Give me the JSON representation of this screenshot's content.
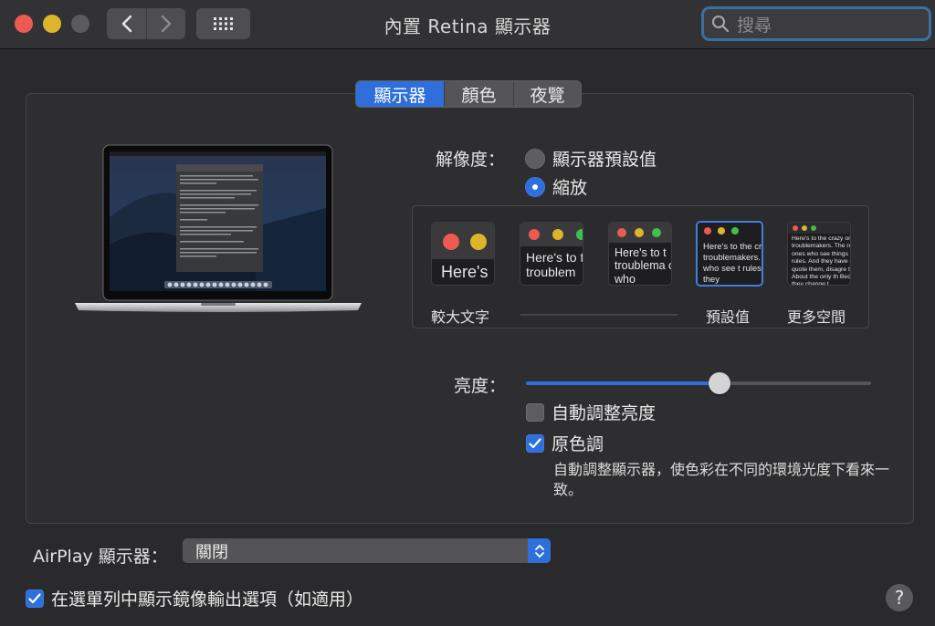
{
  "window": {
    "title": "內置 Retina 顯示器",
    "search_placeholder": "搜尋"
  },
  "tabs": [
    {
      "label": "顯示器",
      "active": true
    },
    {
      "label": "顏色",
      "active": false
    },
    {
      "label": "夜覽",
      "active": false
    }
  ],
  "resolution": {
    "label": "解像度：",
    "options": [
      {
        "label": "顯示器預設值",
        "selected": false
      },
      {
        "label": "縮放",
        "selected": true
      }
    ],
    "scale_options": [
      {
        "preview_text": "Here's",
        "label": "較大文字",
        "selected": false
      },
      {
        "preview_text": "Here's to t troublem",
        "label": "",
        "selected": false
      },
      {
        "preview_text": "Here's to t troublema ones who",
        "label": "",
        "selected": false
      },
      {
        "preview_text": "Here's to the cr troublemakers. ones who see t rules. And they",
        "label": "預設值",
        "selected": true
      },
      {
        "preview_text": "Here's to the crazy one troublemakers. The rou ones who see things dif rules. And they have no can quote them, disagre them. About the only th Because they change t",
        "label": "更多空間",
        "selected": false
      }
    ]
  },
  "brightness": {
    "label": "亮度：",
    "level": 0.56,
    "auto_adjust": {
      "label": "自動調整亮度",
      "checked": false
    },
    "true_tone": {
      "label": "原色調",
      "checked": true
    },
    "true_tone_description": "自動調整顯示器，使色彩在不同的環境光度下看來一致。"
  },
  "airplay": {
    "label": "AirPlay 顯示器：",
    "value": "關閉"
  },
  "mirroring": {
    "label": "在選單列中顯示鏡像輸出選項（如適用）",
    "checked": true
  },
  "help_label": "?",
  "colors": {
    "accent": "#2f6fdb",
    "close": "#ec5a52",
    "minimize": "#ddb52a",
    "zoom_disabled": "#5b5b5d",
    "background": "#2a2a2c"
  },
  "icons": {
    "back": "chevron-left-icon",
    "forward": "chevron-right-icon",
    "all_prefs": "grid-icon",
    "search": "search-icon",
    "popup": "updown-chevron-icon",
    "help": "question-icon"
  }
}
